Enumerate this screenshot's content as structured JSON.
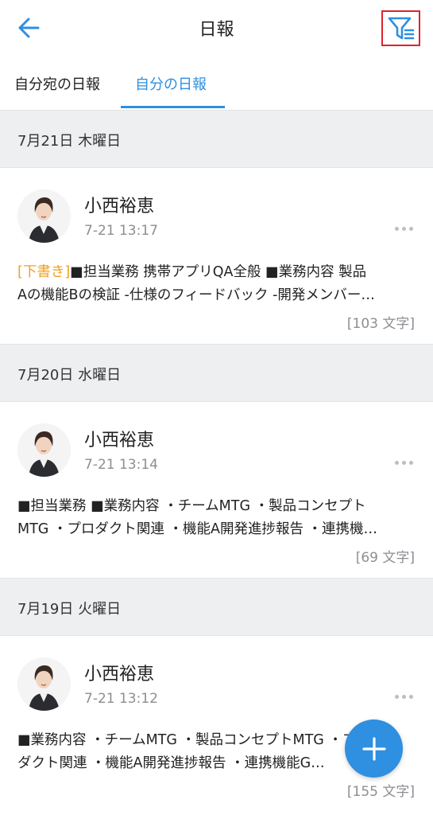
{
  "header": {
    "title": "日報",
    "back_icon": "arrow-left-icon",
    "filter_icon": "filter-list-icon"
  },
  "tabs": [
    {
      "label": "自分宛の日報",
      "active": false
    },
    {
      "label": "自分の日報",
      "active": true
    }
  ],
  "colors": {
    "accent": "#2f8fe0",
    "draft": "#f0a020",
    "highlight_border": "#e0232b",
    "section_bg": "#eeeff1"
  },
  "sections": [
    {
      "date": "7月21日 木曜日",
      "report": {
        "author": "小西裕恵",
        "time": "7-21 13:17",
        "draft_tag": "[下書き]",
        "line1": "■担当業務 携帯アプリQA全般 ■業務内容 製品",
        "line2": "Aの機能Bの検証 -仕様のフィードバック -開発メンバー…",
        "char_count": "[103 文字]"
      }
    },
    {
      "date": "7月20日 水曜日",
      "report": {
        "author": "小西裕恵",
        "time": "7-21 13:14",
        "draft_tag": "",
        "line1": "■担当業務 ■業務内容 ・チームMTG ・製品コンセプト",
        "line2": "MTG ・プロダクト関連 ・機能A開発進捗報告 ・連携機…",
        "char_count": "[69 文字]"
      }
    },
    {
      "date": "7月19日 火曜日",
      "report": {
        "author": "小西裕恵",
        "time": "7-21 13:12",
        "draft_tag": "",
        "line1": "■業務内容 ・チームMTG ・製品コンセプトMTG ・プロ",
        "line2": "ダクト関連 ・機能A開発進捗報告 ・連携機能G…",
        "char_count": "[155 文字]"
      }
    }
  ],
  "fab": {
    "icon": "plus-icon"
  }
}
